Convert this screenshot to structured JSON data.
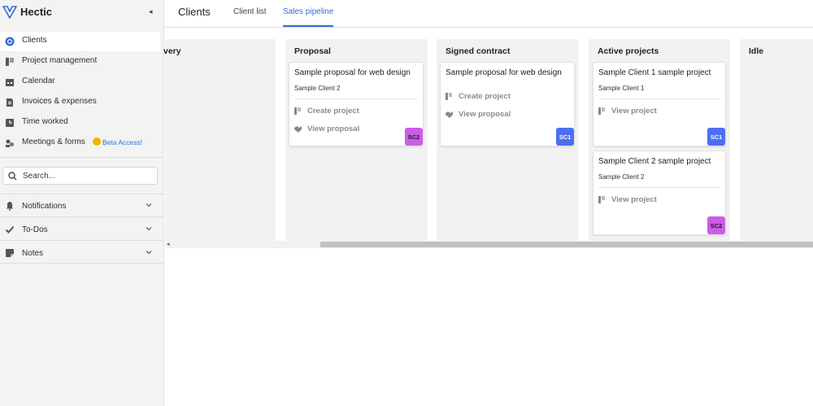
{
  "app": {
    "name": "Hectic",
    "collapse_glyph": "◂"
  },
  "colors": {
    "accent": "#2f6bd9",
    "sc1": "#4c6ef5",
    "sc2": "#cc5de8"
  },
  "sidebar": {
    "nav": [
      {
        "label": "Clients",
        "icon": "clients-icon",
        "active": true
      },
      {
        "label": "Project management",
        "icon": "project-management-icon"
      },
      {
        "label": "Calendar",
        "icon": "calendar-icon"
      },
      {
        "label": "Invoices & expenses",
        "icon": "invoice-icon"
      },
      {
        "label": "Time worked",
        "icon": "clock-icon"
      },
      {
        "label": "Meetings & forms",
        "icon": "meetings-icon"
      }
    ],
    "beta_label": "Beta Access!",
    "search_placeholder": "Search...",
    "sections": [
      {
        "label": "Notifications",
        "icon": "bell-icon"
      },
      {
        "label": "To-Dos",
        "icon": "todo-check-icon"
      },
      {
        "label": "Notes",
        "icon": "notes-icon"
      }
    ]
  },
  "header": {
    "title": "Clients",
    "tabs": [
      {
        "label": "Client list",
        "active": false
      },
      {
        "label": "Sales pipeline",
        "active": true
      }
    ]
  },
  "board": {
    "columns": [
      {
        "title": "very",
        "cards": []
      },
      {
        "title": "Proposal",
        "cards": [
          {
            "title": "Sample proposal for web design",
            "client": "Sample Client 2",
            "actions": [
              "Create project",
              "View proposal"
            ],
            "badge": "SC2"
          }
        ]
      },
      {
        "title": "Signed contract",
        "cards": [
          {
            "title": "Sample proposal for web design",
            "client": "",
            "actions": [
              "Create project",
              "View proposal"
            ],
            "badge": "SC1"
          }
        ]
      },
      {
        "title": "Active projects",
        "cards": [
          {
            "title": "Sample Client 1 sample project",
            "client": "Sample Client 1",
            "actions": [
              "View project"
            ],
            "badge": "SC1"
          },
          {
            "title": "Sample Client 2 sample project",
            "client": "Sample Client 2",
            "actions": [
              "View project"
            ],
            "badge": "SC2"
          }
        ]
      },
      {
        "title": "Idle",
        "cards": []
      }
    ]
  },
  "scrollbar": {
    "left_arrow": "◂"
  }
}
